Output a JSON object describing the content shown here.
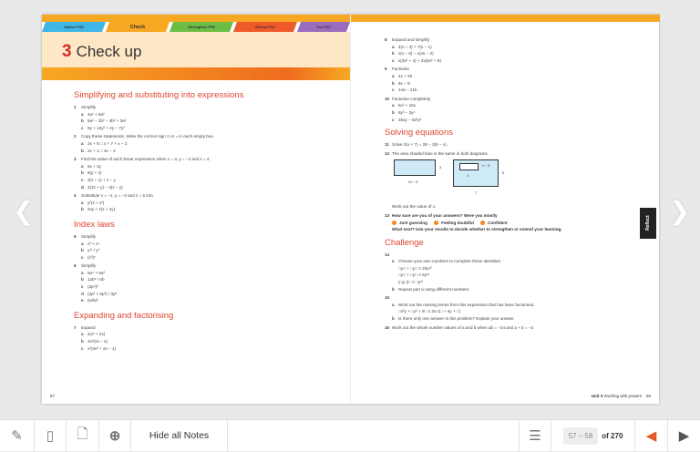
{
  "header": {
    "tabs": [
      {
        "label": "Master P45",
        "color": "#3fb6e6"
      },
      {
        "label": "Check",
        "color": "#f7a823"
      },
      {
        "label": "Strengthen P59",
        "color": "#6cbd45"
      },
      {
        "label": "Extend P63",
        "color": "#ee5a2a"
      },
      {
        "label": "Test P67",
        "color": "#9b6cbd"
      }
    ],
    "unit_number": "3",
    "title": "Check up"
  },
  "left_page": {
    "sections": [
      {
        "heading": "Simplifying and substituting into expressions",
        "questions": [
          {
            "num": "1",
            "text": "Simplify",
            "parts": [
              [
                "a",
                "4a² + 6a²"
              ],
              [
                "b",
                "8a² − 2b² − 4b² + 3a²"
              ],
              [
                "c",
                "9y + 12y² + 2y − 7y²"
              ]
            ]
          },
          {
            "num": "2",
            "text": "Copy these statements. Write the correct sign ≡ or = in each empty box.",
            "parts": [
              [
                "a",
                "2x + 5 □ x + 7 + x − 2"
              ],
              [
                "b",
                "2x + 1 □ 4x − 3"
              ]
            ]
          },
          {
            "num": "3",
            "text": "Find the value of each linear expression when x = 3, y = −2 and z = 4.",
            "parts": [
              [
                "a",
                "5x + 2y"
              ],
              [
                "b",
                "6(y + z)"
              ],
              [
                "c",
                "3(z + 1) + x − y"
              ],
              [
                "d",
                "4(2z + y) − 3(z − y)"
              ]
            ]
          },
          {
            "num": "4",
            "text": "Substitute x = −1, y = −3 and z = 5 into",
            "parts": [
              [
                "a",
                "y²(z + x²)"
              ],
              [
                "b",
                "2xy + z(z + 2y)"
              ]
            ]
          }
        ]
      },
      {
        "heading": "Index laws",
        "questions": [
          {
            "num": "5",
            "text": "Simplify",
            "parts": [
              [
                "a",
                "x³ × x⁴"
              ],
              [
                "b",
                "y¹¹ / y⁵"
              ],
              [
                "c",
                "(z³)⁵"
              ]
            ]
          },
          {
            "num": "6",
            "text": "Simplify",
            "parts": [
              [
                "a",
                "5a⁴ × 6a³"
              ],
              [
                "b",
                "12b⁶ / 6b"
              ],
              [
                "c",
                "(3p⁴)²"
              ],
              [
                "d",
                "(2p² × 6p³) / 3p²"
              ],
              [
                "e",
                "(w/5)²"
              ]
            ]
          }
        ]
      },
      {
        "heading": "Expanding and factorising",
        "questions": [
          {
            "num": "7",
            "text": "Expand",
            "parts": [
              [
                "a",
                "x(x² + 2x)"
              ],
              [
                "b",
                "3x²(2x − 4)"
              ],
              [
                "c",
                "x²(3x² + 2x − 1)"
              ]
            ]
          }
        ]
      }
    ],
    "page_number": "57"
  },
  "right_page": {
    "q_top": [
      {
        "num": "8",
        "text": "Expand and simplify",
        "parts": [
          [
            "a",
            "4(x + 3) + 7(x − 1)"
          ],
          [
            "b",
            "x(x − 6) − x(4x − 2)"
          ],
          [
            "c",
            "x(3x² + 4) + 2x(5x² + 9)"
          ]
        ]
      },
      {
        "num": "9",
        "text": "Factorise",
        "parts": [
          [
            "a",
            "4x + 20"
          ],
          [
            "b",
            "6x − 9"
          ],
          [
            "c",
            "14a − 21b"
          ]
        ]
      },
      {
        "num": "10",
        "text": "Factorise completely",
        "parts": [
          [
            "a",
            "6x² + 16x"
          ],
          [
            "b",
            "8y³ − 2y⁴"
          ],
          [
            "c",
            "16xy − 8x²y²"
          ]
        ]
      }
    ],
    "solving": {
      "heading": "Solving equations",
      "q11": {
        "num": "11",
        "text": "Solve 2(x + 7) = 28 − 3(6 − x)."
      },
      "q12": {
        "num": "12",
        "text": "The area shaded blue is the same in both diagrams.",
        "labels": {
          "w1": "2x − 5",
          "h1": "3",
          "w2": "7",
          "h2": "5",
          "w3": "4",
          "h3": "x − 5"
        },
        "after": "Work out the value of x."
      },
      "q13": {
        "num": "13",
        "text": "How sure are you of your answers? Were you mostly",
        "options": [
          "Just guessing",
          "Feeling doubtful",
          "Confident"
        ],
        "next": "What next? Use your results to decide whether to strengthen or extend your learning."
      }
    },
    "challenge": {
      "heading": "Challenge",
      "questions": [
        {
          "num": "14",
          "text": "",
          "parts": [
            [
              "a",
              "Choose your own numbers to complete these identities."
            ],
            [
              "",
              "□y□ + □y□ ≡ 20y¹²"
            ],
            [
              "",
              "□y□ + □y□ ≡ 6y¹²"
            ],
            [
              "",
              "(□y□)□ ≡ □y¹²"
            ],
            [
              "b",
              "Repeat part a using different numbers."
            ]
          ]
        },
        {
          "num": "15",
          "text": "",
          "parts": [
            [
              "a",
              "Work out the missing terms from this expression that has been factorised."
            ],
            [
              "",
              "□x²y + □y² + 9□ ≡ 3x□(□ + 4y + □)"
            ],
            [
              "b",
              "Is there only one answer to this problem? Explain your answer."
            ]
          ]
        },
        {
          "num": "16",
          "text": "Work out the whole number values of a and b when ab = −24 and a + b = −2.",
          "parts": []
        }
      ]
    },
    "footer": {
      "unit": "Unit 3",
      "title": "Working with powers",
      "page_number": "58"
    }
  },
  "reflect_label": "Reflect",
  "toolbar": {
    "hide_notes": "Hide all Notes",
    "page_range": "57 – 58",
    "page_total": "of 270"
  }
}
